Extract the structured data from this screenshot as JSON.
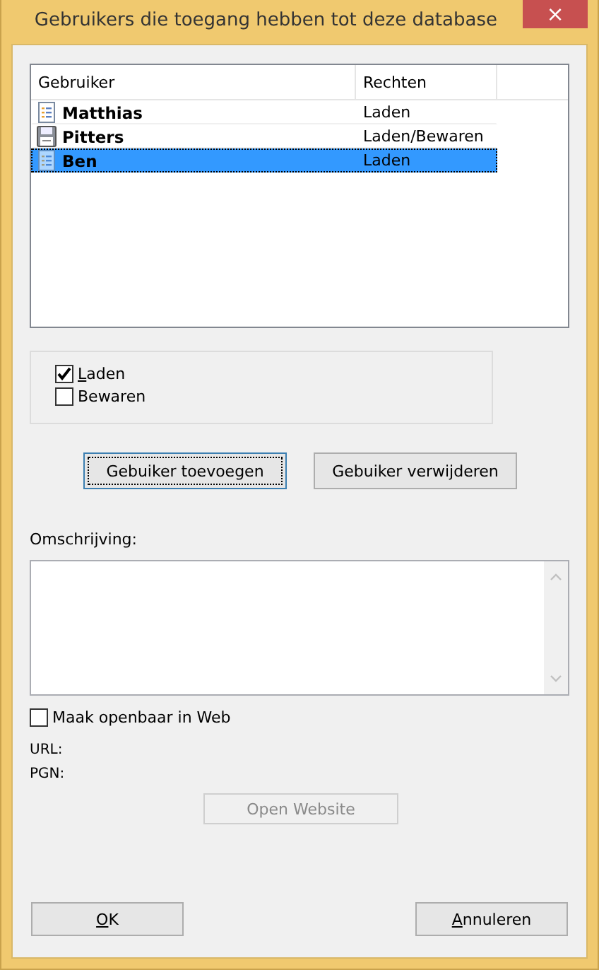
{
  "window": {
    "title": "Gebruikers die toegang hebben tot deze database",
    "close": "×"
  },
  "users": {
    "columns": [
      "Gebruiker",
      "Rechten"
    ],
    "rows": [
      {
        "name": "Matthias",
        "rights": "Laden",
        "kind": "document",
        "selected": false
      },
      {
        "name": "Pitters",
        "rights": "Laden/Bewaren",
        "kind": "disk",
        "selected": false
      },
      {
        "name": "Ben",
        "rights": "Laden",
        "kind": "document",
        "selected": true
      }
    ]
  },
  "permissions": [
    {
      "label": "Laden",
      "first_letter_underlined": true,
      "checked": true
    },
    {
      "label": "Bewaren",
      "checked": false
    }
  ],
  "user_buttons": [
    {
      "label": "Gebuiker toevoegen",
      "focused": true
    },
    {
      "label": "Gebuiker verwijderen",
      "focused": false
    }
  ],
  "description": {
    "label": "Omschrijving:"
  },
  "publish": {
    "label": "Maak openbaar in Web",
    "checked": false
  },
  "url_label": "URL:",
  "pgn_label": "PGN:",
  "open_website": {
    "label": "Open Website",
    "disabled": true
  },
  "footer_buttons": [
    {
      "label": "OK",
      "first_letter_underlined": true
    },
    {
      "label": "Annuleren",
      "first_letter_underlined": true
    }
  ]
}
